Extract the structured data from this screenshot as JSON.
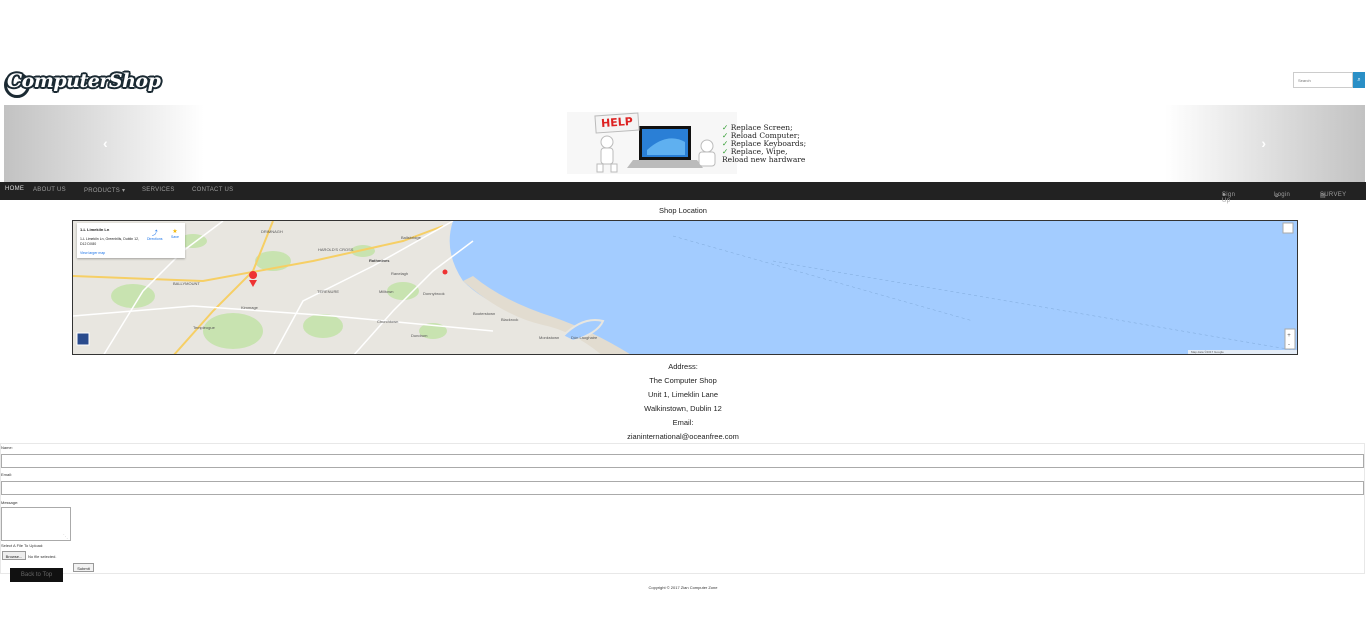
{
  "logo": {
    "text": "ComputerShop"
  },
  "search": {
    "placeholder": "Search",
    "button_icon": "search-icon"
  },
  "carousel": {
    "prev_icon": "chevron-left-icon",
    "next_icon": "chevron-right-icon",
    "slide": {
      "sign_text": "HELP",
      "items": [
        "Replace Screen;",
        "Reload Computer;",
        "Replace Keyboards;",
        "Replace, Wipe,"
      ],
      "last_line": "Reload new hardware"
    }
  },
  "nav": {
    "home": "HOME",
    "about": "ABOUT US",
    "products": "PRODUCTS ▾",
    "services": "SERVICES",
    "contact": "CONTACT US",
    "signup": "Sign Up",
    "login": "Login",
    "survey": "SURVEY"
  },
  "location": {
    "title": "Shop Location",
    "map_card": {
      "place": "1-L Limekiln Ln",
      "address": "1-L Limekiln Ln, Greenhills, Dublin 12, D12 DX80",
      "directions": "Directions",
      "save": "Save",
      "larger": "View larger map"
    },
    "map_labels": [
      "DRIMNAGH",
      "Ballsbridge",
      "HAROLD'S CROSS",
      "Rathmines",
      "Ranelagh",
      "BALLYMOUNT",
      "TERENURE",
      "Milltown",
      "Donnybrook",
      "Booterstown",
      "Blackrock",
      "Churchtown",
      "Dundrum",
      "Kimmage",
      "Templeogue",
      "Monkstown",
      "Dún Laoghaire"
    ],
    "map_copyright": "Map data ©2017 Google"
  },
  "address": {
    "heading": "Address:",
    "name": "The Computer Shop",
    "line1": "Unit 1, Limeklin Lane",
    "line2": "Walkinstown, Dublin 12",
    "email_label": "Email:",
    "email": "zianinternational@oceanfree.com"
  },
  "form": {
    "name_label": "Name:",
    "email_label": "Email:",
    "message_label": "Message:",
    "file_label": "Select A File To Upload:",
    "browse": "Browse...",
    "no_file": "No file selected.",
    "submit": "Submit"
  },
  "footer": {
    "back_to_top": "Back to Top",
    "copyright": "Copyright © 2017 Zian Computer Zone"
  },
  "colors": {
    "nav_bg": "#222222",
    "water": "#a3ccff",
    "land": "#e8e6e0",
    "park": "#c8e3b0",
    "accent": "#2a8fc6"
  }
}
